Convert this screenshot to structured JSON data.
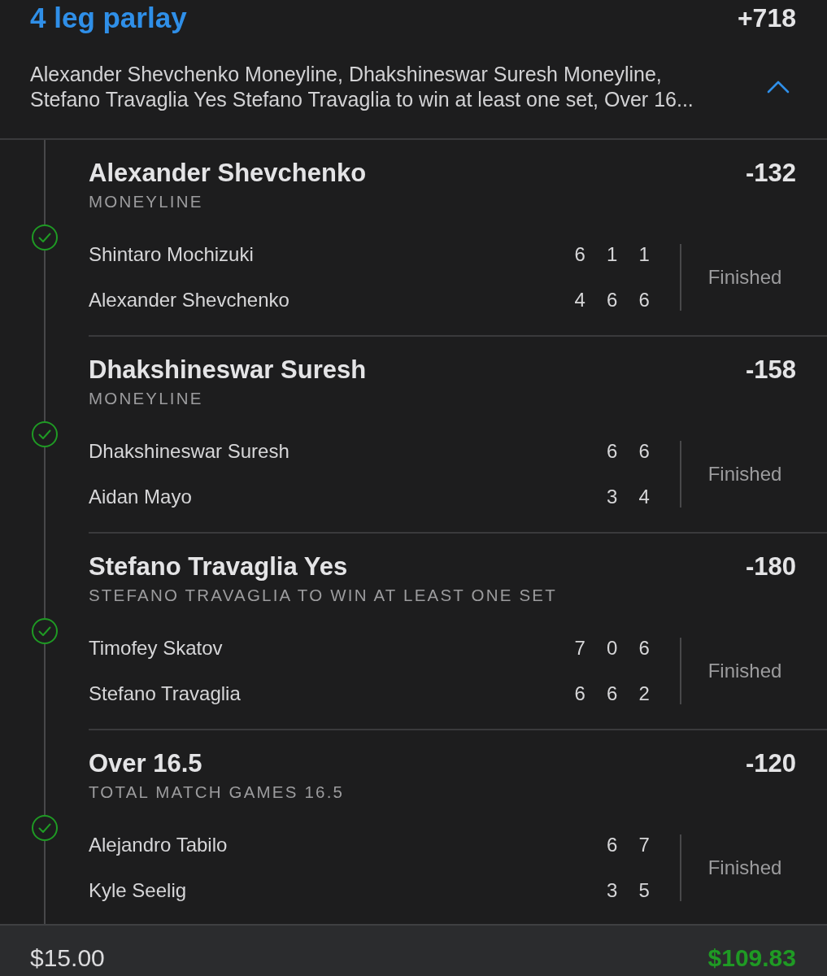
{
  "parlay": {
    "title": "4 leg parlay",
    "odds": "+718",
    "summary": "Alexander Shevchenko Moneyline, Dhakshineswar Suresh Moneyline, Stefano Travaglia Yes Stefano Travaglia to win at least one set, Over 16...",
    "expanded": true
  },
  "legs": [
    {
      "selection": "Alexander Shevchenko",
      "market": "MONEYLINE",
      "odds": "-132",
      "won": true,
      "players": [
        {
          "name": "Shintaro Mochizuki",
          "scores": [
            "6",
            "1",
            "1"
          ]
        },
        {
          "name": "Alexander Shevchenko",
          "scores": [
            "4",
            "6",
            "6"
          ]
        }
      ],
      "status": "Finished"
    },
    {
      "selection": "Dhakshineswar Suresh",
      "market": "MONEYLINE",
      "odds": "-158",
      "won": true,
      "players": [
        {
          "name": "Dhakshineswar Suresh",
          "scores": [
            "6",
            "6"
          ]
        },
        {
          "name": "Aidan Mayo",
          "scores": [
            "3",
            "4"
          ]
        }
      ],
      "status": "Finished"
    },
    {
      "selection": "Stefano Travaglia Yes",
      "market": "STEFANO TRAVAGLIA TO WIN AT LEAST ONE SET",
      "odds": "-180",
      "won": true,
      "players": [
        {
          "name": "Timofey Skatov",
          "scores": [
            "7",
            "0",
            "6"
          ]
        },
        {
          "name": "Stefano Travaglia",
          "scores": [
            "6",
            "6",
            "2"
          ]
        }
      ],
      "status": "Finished"
    },
    {
      "selection": "Over 16.5",
      "market": "TOTAL MATCH GAMES 16.5",
      "odds": "-120",
      "won": true,
      "players": [
        {
          "name": "Alejandro Tabilo",
          "scores": [
            "6",
            "7"
          ]
        },
        {
          "name": "Kyle Seelig",
          "scores": [
            "3",
            "5"
          ]
        }
      ],
      "status": "Finished"
    }
  ],
  "footer": {
    "stake": "$15.00",
    "payout": "$109.83"
  }
}
